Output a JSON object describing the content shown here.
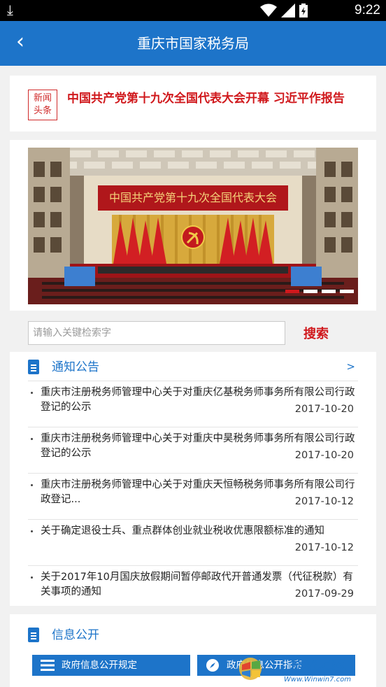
{
  "status_bar": {
    "time": "9:22"
  },
  "app_bar": {
    "title": "重庆市国家税务局",
    "back_icon": "‹"
  },
  "headline": {
    "stamp_line1": "新闻",
    "stamp_line2": "头条",
    "text": "中国共产党第十九次全国代表大会开幕 习近平作报告"
  },
  "banner": {
    "caption": "中国共产党第十九次全国代表大会",
    "slide_count": 4,
    "active_slide": 1
  },
  "search": {
    "placeholder": "请输入关键检索字",
    "button_label": "搜索"
  },
  "notices": {
    "title": "通知公告",
    "more": ">",
    "items": [
      {
        "title": "重庆市注册税务师管理中心关于对重庆亿基税务师事务所有限公司行政登记的公示",
        "date": "2017-10-20"
      },
      {
        "title": "重庆市注册税务师管理中心关于对重庆中昊税务师事务所有限公司行政登记的公示",
        "date": "2017-10-20"
      },
      {
        "title": "重庆市注册税务师管理中心关于对重庆天恒畅税务师事务所有限公司行政登记...",
        "date": "2017-10-12"
      },
      {
        "title": "关于确定退役士兵、重点群体创业就业税收优惠限额标准的通知",
        "date": "2017-10-12"
      },
      {
        "title": "关于2017年10月国庆放假期间暂停邮政代开普通发票（代征税款）有关事项的通知",
        "date": "2017-09-29"
      }
    ]
  },
  "info_public": {
    "title": "信息公开",
    "buttons": [
      {
        "label": "政府信息公开规定",
        "icon": "list-icon"
      },
      {
        "label": "政府信息公开指南",
        "icon": "compass-icon"
      }
    ]
  },
  "watermark": {
    "brand": "系统之家",
    "url": "Www.Winwin7.com"
  },
  "colors": {
    "primary": "#1d74c9",
    "accent_red": "#d0181c",
    "background": "#f1f1f1"
  }
}
